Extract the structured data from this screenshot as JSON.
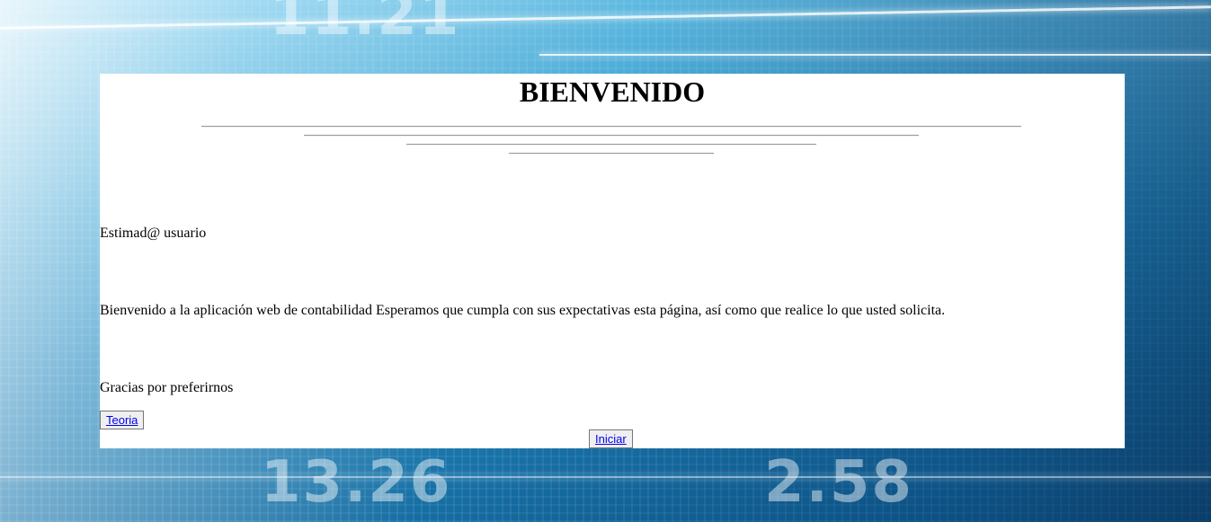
{
  "page": {
    "title": "BIENVENIDO"
  },
  "content": {
    "greeting": "Estimad@ usuario",
    "message": "Bienvenido a la aplicación web de contabilidad Esperamos que cumpla con sus expectativas esta página, así como que realice lo que usted solicita.",
    "closing": "Gracias por preferirnos"
  },
  "buttons": {
    "teoria_label": "Teoria",
    "iniciar_label": "Iniciar"
  },
  "colors": {
    "panel_background": "#ffffff",
    "link_color": "#0000ee",
    "background_accent": "#1a78b0"
  }
}
